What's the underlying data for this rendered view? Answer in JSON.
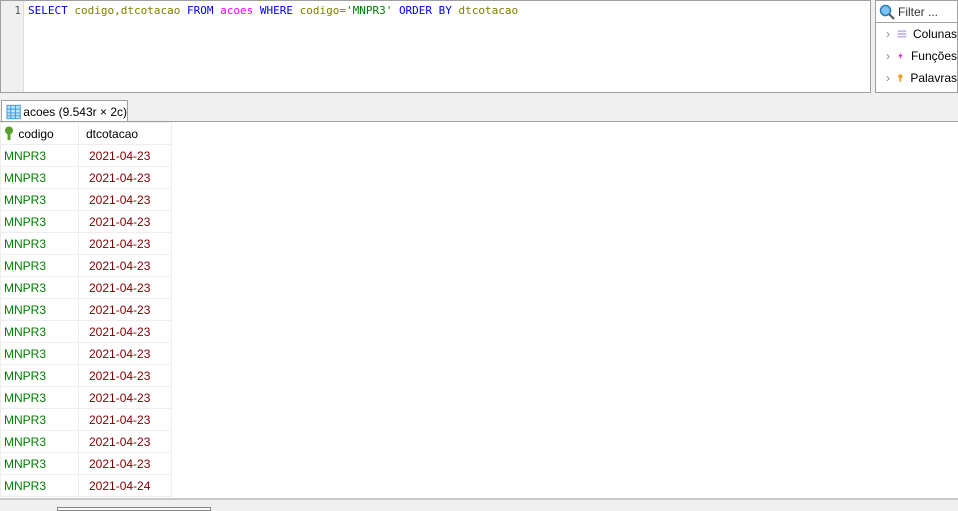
{
  "editor": {
    "line_number": "1",
    "sql": {
      "select": "SELECT",
      "cols": "codigo,dtcotacao",
      "from": "FROM",
      "table": "acoes",
      "where": "WHERE",
      "cond": "codigo=",
      "value": "'MNPR3'",
      "order": "ORDER BY",
      "ordcol": "dtcotacao"
    }
  },
  "side": {
    "filter_placeholder": "Filter ...",
    "items": [
      {
        "label": "Colunas",
        "icon": "columns-icon"
      },
      {
        "label": "Funções",
        "icon": "function-icon"
      },
      {
        "label": "Palavras",
        "icon": "key-icon"
      }
    ]
  },
  "tab": {
    "label": "acoes (9.543r × 2c)"
  },
  "grid": {
    "columns": [
      "codigo",
      "dtcotacao"
    ],
    "rows": [
      [
        "MNPR3",
        "2021-04-23"
      ],
      [
        "MNPR3",
        "2021-04-23"
      ],
      [
        "MNPR3",
        "2021-04-23"
      ],
      [
        "MNPR3",
        "2021-04-23"
      ],
      [
        "MNPR3",
        "2021-04-23"
      ],
      [
        "MNPR3",
        "2021-04-23"
      ],
      [
        "MNPR3",
        "2021-04-23"
      ],
      [
        "MNPR3",
        "2021-04-23"
      ],
      [
        "MNPR3",
        "2021-04-23"
      ],
      [
        "MNPR3",
        "2021-04-23"
      ],
      [
        "MNPR3",
        "2021-04-23"
      ],
      [
        "MNPR3",
        "2021-04-23"
      ],
      [
        "MNPR3",
        "2021-04-23"
      ],
      [
        "MNPR3",
        "2021-04-23"
      ],
      [
        "MNPR3",
        "2021-04-23"
      ],
      [
        "MNPR3",
        "2021-04-24"
      ]
    ]
  }
}
